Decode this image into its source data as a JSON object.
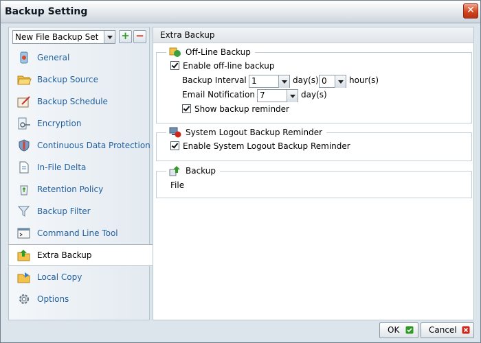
{
  "window": {
    "title": "Backup Setting"
  },
  "sidebar": {
    "backup_set": "New File Backup Set",
    "items": [
      {
        "label": "General",
        "icon": "general-icon"
      },
      {
        "label": "Backup Source",
        "icon": "folder-open-icon"
      },
      {
        "label": "Backup Schedule",
        "icon": "schedule-icon"
      },
      {
        "label": "Encryption",
        "icon": "key-icon"
      },
      {
        "label": "Continuous Data Protection",
        "icon": "shield-icon"
      },
      {
        "label": "In-File Delta",
        "icon": "document-icon"
      },
      {
        "label": "Retention Policy",
        "icon": "recycle-icon"
      },
      {
        "label": "Backup Filter",
        "icon": "funnel-icon"
      },
      {
        "label": "Command Line Tool",
        "icon": "terminal-icon"
      },
      {
        "label": "Extra Backup",
        "icon": "extra-backup-icon",
        "active": true
      },
      {
        "label": "Local Copy",
        "icon": "local-copy-icon"
      },
      {
        "label": "Options",
        "icon": "gear-icon"
      }
    ]
  },
  "main": {
    "header": "Extra Backup",
    "offline": {
      "legend": "Off-Line Backup",
      "enable_label": "Enable off-line backup",
      "interval_label": "Backup Interval :",
      "interval_days": "1",
      "days_unit": "day(s)",
      "interval_hours": "0",
      "hours_unit": "hour(s)",
      "email_label": "Email Notification :",
      "email_days": "7",
      "email_unit": "day(s)",
      "reminder_label": "Show backup reminder"
    },
    "logout": {
      "legend": "System Logout Backup Reminder",
      "enable_label": "Enable System Logout Backup Reminder"
    },
    "backup": {
      "legend": "Backup",
      "value": "File"
    }
  },
  "footer": {
    "ok_label": "OK",
    "cancel_label": "Cancel"
  },
  "colors": {
    "nav_text": "#1f5f9e",
    "accent_green": "#2f9b25",
    "accent_red": "#d0261a"
  }
}
